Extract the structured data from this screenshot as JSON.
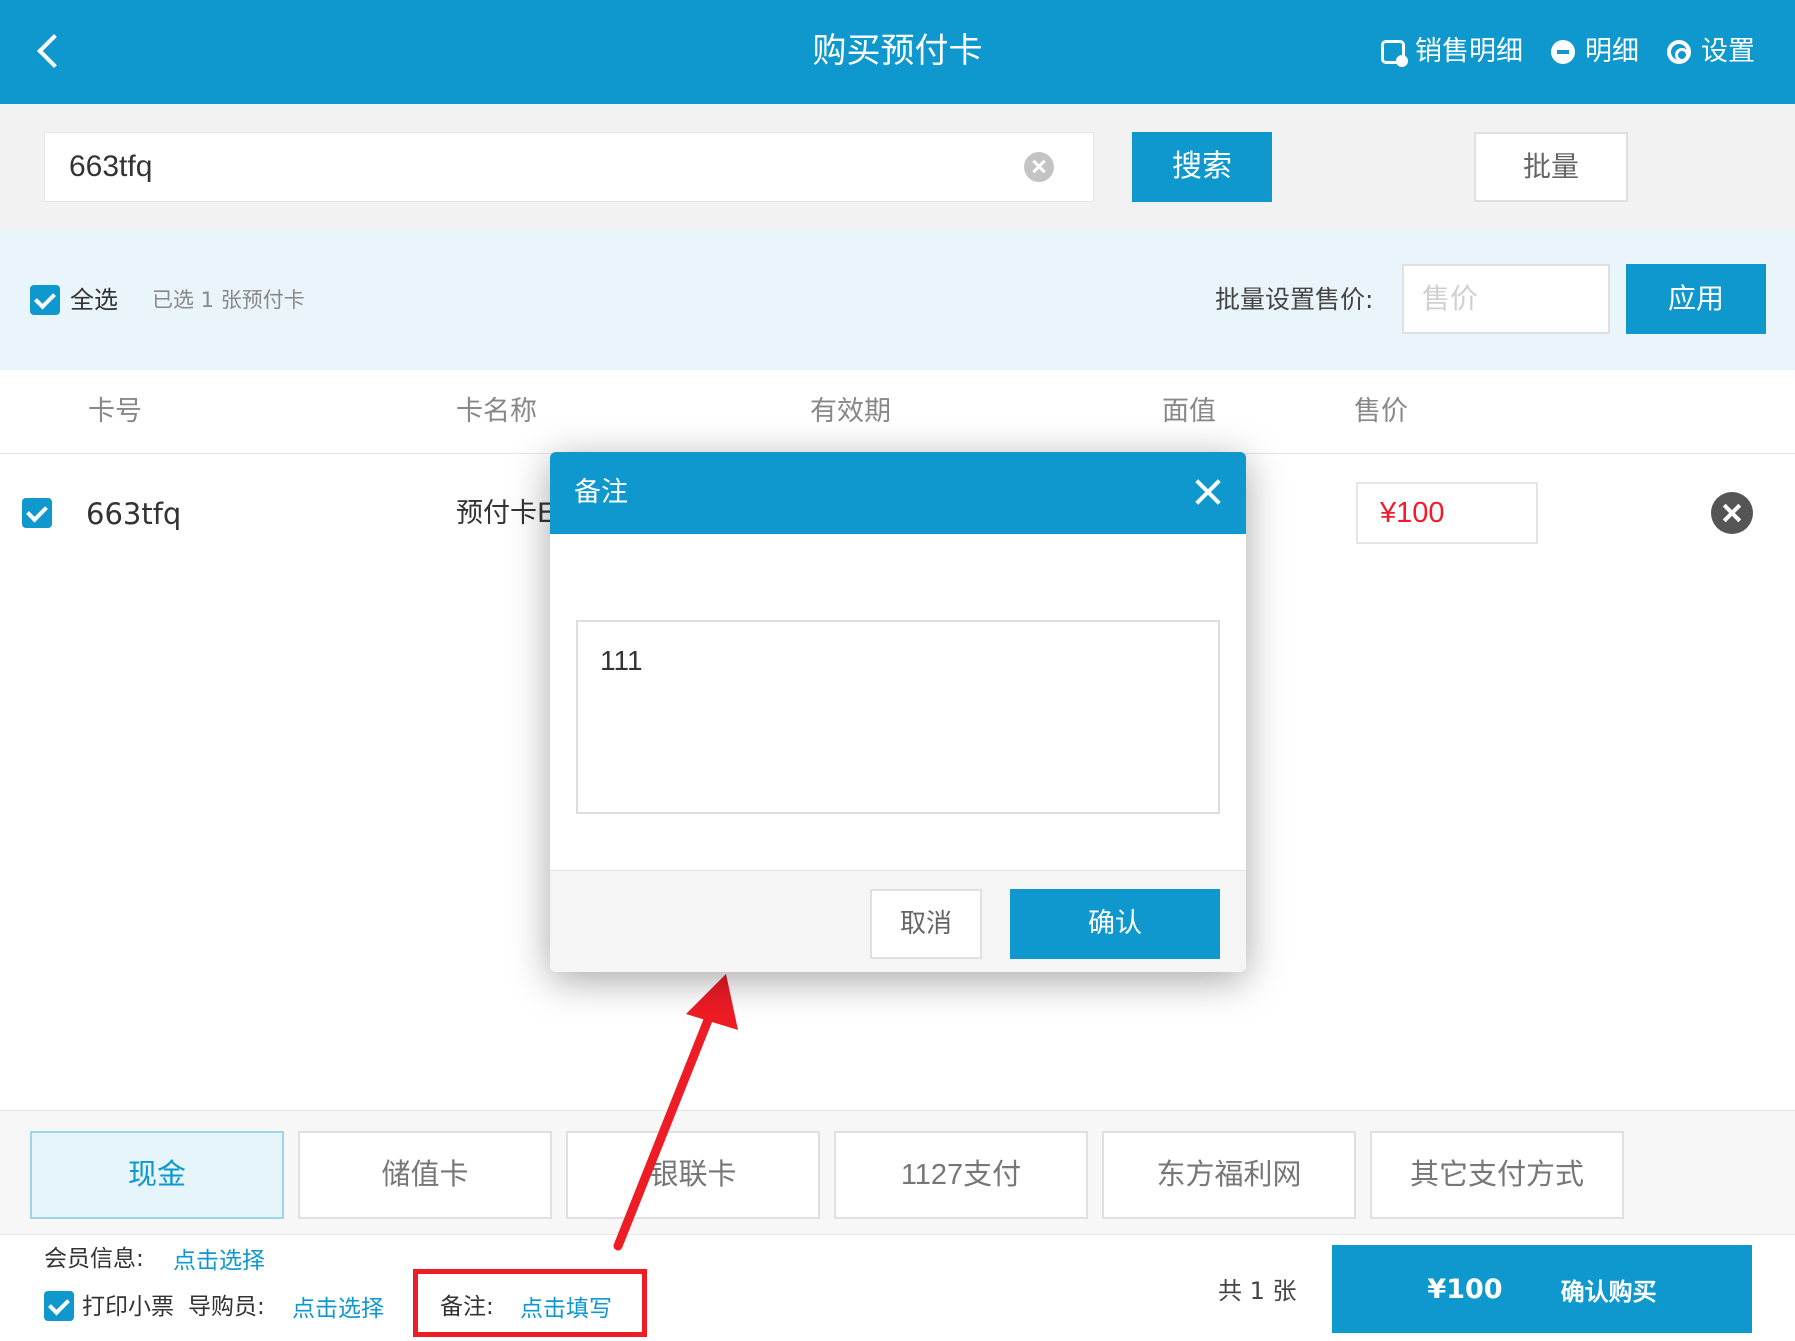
{
  "header": {
    "title": "购买预付卡",
    "links": [
      {
        "label": "销售明细",
        "icon": "sales-detail-icon"
      },
      {
        "label": "明细",
        "icon": "detail-icon"
      },
      {
        "label": "设置",
        "icon": "gear-icon"
      }
    ]
  },
  "search": {
    "value": "663tfq",
    "button": "搜索",
    "batch_button": "批量"
  },
  "selection": {
    "select_all_label": "全选",
    "selected_count_text": "已选 1 张预付卡",
    "batch_price_label": "批量设置售价:",
    "batch_price_placeholder": "售价",
    "apply_button": "应用"
  },
  "table": {
    "columns": [
      "卡号",
      "卡名称",
      "有效期",
      "面值",
      "售价"
    ],
    "rows": [
      {
        "card_no": "663tfq",
        "card_name": "预付卡E",
        "price": "¥100"
      }
    ]
  },
  "payment": {
    "methods": [
      "现金",
      "储值卡",
      "银联卡",
      "1127支付",
      "东方福利网",
      "其它支付方式"
    ],
    "active": "现金"
  },
  "bottom": {
    "member_label": "会员信息:",
    "member_link": "点击选择",
    "print_label": "打印小票",
    "guide_label": "导购员:",
    "guide_link": "点击选择",
    "remark_label": "备注:",
    "remark_link": "点击填写",
    "total_count": "共 1 张",
    "total_amount": "¥100",
    "confirm_label": "确认购买"
  },
  "dialog": {
    "title": "备注",
    "textarea_value": "111",
    "cancel_button": "取消",
    "ok_button": "确认"
  },
  "colors": {
    "primary": "#0e98cd",
    "price_red": "#f21a2b",
    "annotation_red": "#ee1c25"
  }
}
